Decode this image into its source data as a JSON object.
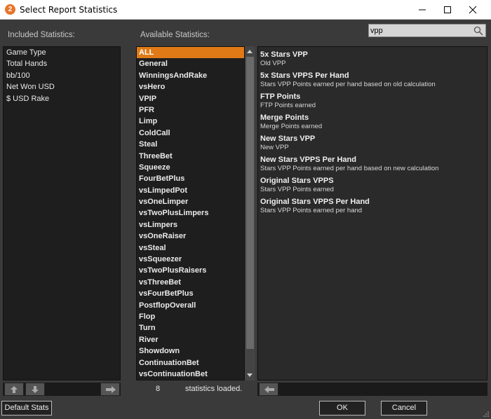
{
  "window": {
    "title": "Select Report Statistics",
    "app_icon_glyph": "2"
  },
  "headers": {
    "included": "Included Statistics:",
    "available": "Available Statistics:"
  },
  "search": {
    "value": "vpp"
  },
  "included": [
    "Game Type",
    "Total Hands",
    "bb/100",
    "Net Won USD",
    "$ USD Rake"
  ],
  "available": [
    "ALL",
    "General",
    "WinningsAndRake",
    "vsHero",
    "VPIP",
    "PFR",
    "Limp",
    "ColdCall",
    "Steal",
    "ThreeBet",
    "Squeeze",
    "FourBetPlus",
    "vsLimpedPot",
    "vsOneLimper",
    "vsTwoPlusLimpers",
    "vsLimpers",
    "vsOneRaiser",
    "vsSteal",
    "vsSqueezer",
    "vsTwoPlusRaisers",
    "vsThreeBet",
    "vsFourBetPlus",
    "PostflopOverall",
    "Flop",
    "Turn",
    "River",
    "Showdown",
    "ContinuationBet",
    "vsContinuationBet"
  ],
  "selected_available": "ALL",
  "descriptions": [
    {
      "title": "5x Stars VPP",
      "sub": "Old VPP"
    },
    {
      "title": "5x Stars VPPS Per Hand",
      "sub": "Stars VPP Points earned per hand based on old calculation"
    },
    {
      "title": "FTP Points",
      "sub": "FTP Points earned"
    },
    {
      "title": "Merge Points",
      "sub": "Merge Points earned"
    },
    {
      "title": "New Stars VPP",
      "sub": "New VPP"
    },
    {
      "title": "New Stars VPPS Per Hand",
      "sub": "Stars VPP Points earned per hand based on new calculation"
    },
    {
      "title": "Original Stars VPPS",
      "sub": "Stars VPP Points earned"
    },
    {
      "title": "Original Stars VPPS Per Hand",
      "sub": "Stars VPP Points earned per hand"
    }
  ],
  "status": {
    "count": "8",
    "label": "statistics loaded."
  },
  "buttons": {
    "default": "Default Stats",
    "ok": "OK",
    "cancel": "Cancel"
  },
  "colors": {
    "selection": "#e07a16",
    "app_icon": "#e8742a"
  },
  "icons": [
    "app-logo-icon",
    "minimize-icon",
    "maximize-icon",
    "close-icon",
    "search-icon",
    "arrow-up-icon",
    "arrow-down-icon",
    "arrow-right-icon",
    "arrow-left-icon",
    "resize-grip-icon"
  ]
}
